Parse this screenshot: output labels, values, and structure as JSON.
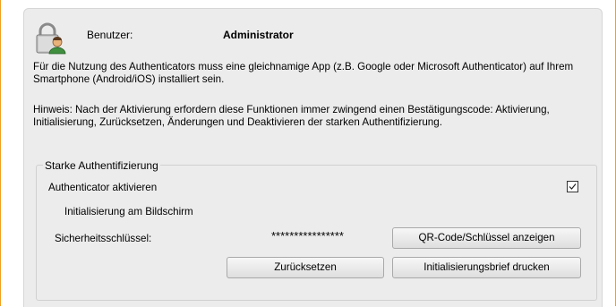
{
  "header": {
    "user_label": "Benutzer:",
    "user_value": "Administrator",
    "icon": "lock-user-icon"
  },
  "info": {
    "paragraph1": "Für die Nutzung des Authenticators muss eine gleichnamige App (z.B. Google oder Microsoft Authenticator) auf Ihrem Smartphone (Android/iOS) installiert sein.",
    "paragraph2": "Hinweis: Nach der Aktivierung erfordern diese Funktionen immer zwingend einen Bestätigungscode: Aktivierung, Initialisierung, Zurücksetzen, Änderungen und Deaktivieren der starken Authentifizierung."
  },
  "strong_auth": {
    "group_title": "Starke Authentifizierung",
    "activate_label": "Authenticator aktivieren",
    "activate_checked": true,
    "init_label": "Initialisierung am Bildschirm",
    "key_label": "Sicherheitsschlüssel:",
    "key_value": "****************",
    "qr_button": "QR-Code/Schlüssel anzeigen",
    "reset_button": "Zurücksetzen",
    "letter_button": "Initialisierungsbrief drucken"
  },
  "colors": {
    "panel_bg": "#ececec",
    "frame_accent": "#f0a020"
  }
}
